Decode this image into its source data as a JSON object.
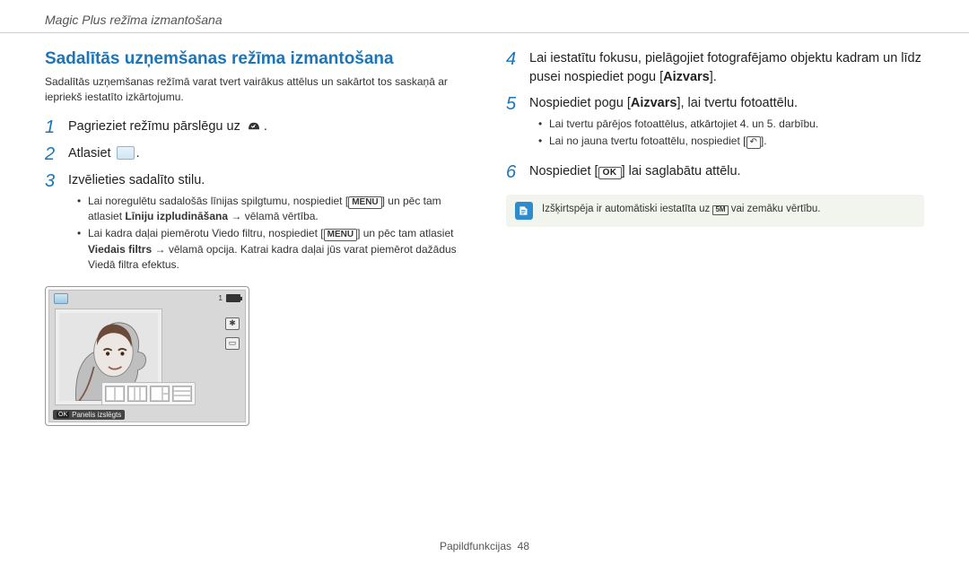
{
  "header": {
    "breadcrumb": "Magic Plus režīma izmantošana"
  },
  "section": {
    "title": "Sadalītās uzņemšanas režīma izmantošana",
    "intro": "Sadalītās uzņemšanas režīmā varat tvert vairākus attēlus un sakārtot tos saskaņā ar iepriekš iestatīto izkārtojumu."
  },
  "steps": {
    "s1_pre": "Pagrieziet režīmu pārslēgu uz ",
    "s1_post": ".",
    "s2_pre": "Atlasiet ",
    "s2_post": ".",
    "s3": "Izvēlieties sadalīto stilu.",
    "s3a_pre": "Lai noregulētu sadalošās līnijas spilgtumu, nospiediet [",
    "s3a_mid": "] un pēc tam atlasiet ",
    "s3a_bold": "Līniju izpludināšana",
    "s3a_post": " → vēlamā vērtība.",
    "s3b_pre": "Lai kadra daļai piemērotu Viedo filtru, nospiediet [",
    "s3b_mid": "] un pēc tam atlasiet ",
    "s3b_bold": "Viedais filtrs",
    "s3b_post": " → vēlamā opcija. Katrai kadra daļai jūs varat piemērot dažādus Viedā filtra efektus.",
    "s4_pre": "Lai iestatītu fokusu, pielāgojiet fotografējamo objektu kadram un līdz pusei nospiediet pogu [",
    "s4_bold": "Aizvars",
    "s4_post": "].",
    "s5_pre": "Nospiediet pogu [",
    "s5_bold": "Aizvars",
    "s5_post": "], lai tvertu fotoattēlu.",
    "s5a": "Lai tvertu pārējos fotoattēlus, atkārtojiet 4. un 5. darbību.",
    "s5b_pre": "Lai no jauna tvertu fotoattēlu, nospiediet [",
    "s5b_post": "].",
    "s6_pre": "Nospiediet [",
    "s6_post": "] lai saglabātu attēlu."
  },
  "lcd": {
    "count": "1",
    "caption_label": "Panelis izslēgts"
  },
  "note": {
    "text_pre": "Izšķirtspēja ir automātiski iestatīta uz ",
    "text_post": " vai zemāku vērtību.",
    "size_label": "5M"
  },
  "menu_label": "MENU",
  "ok_label": "OK",
  "back_glyph": "↶",
  "footer": {
    "label": "Papildfunkcijas",
    "page": "48"
  }
}
